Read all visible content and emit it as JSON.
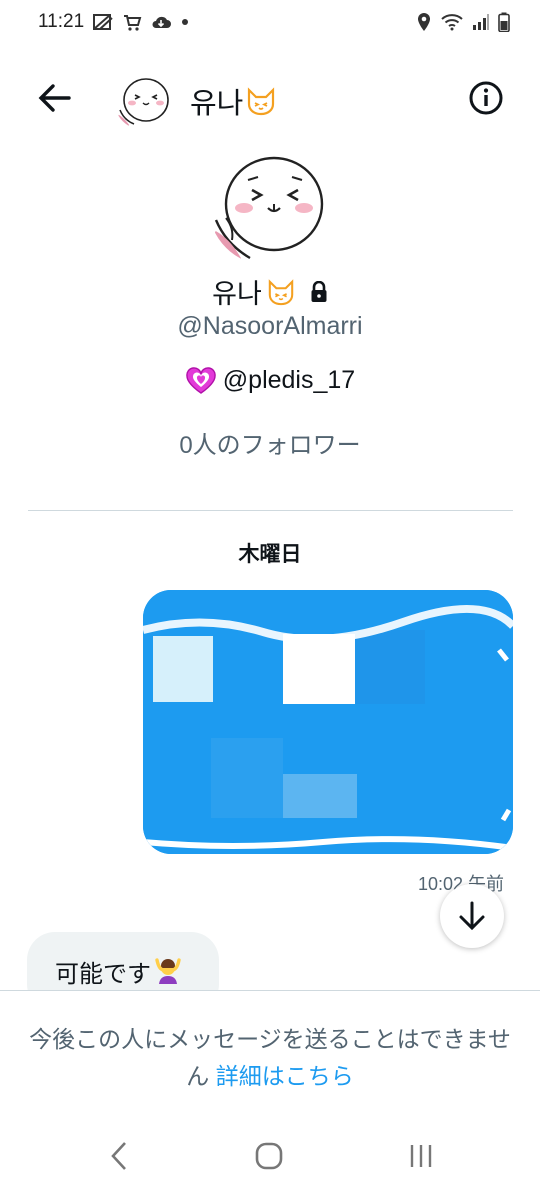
{
  "status_bar": {
    "time": "11:21",
    "left_icons": [
      "muted-cellular-icon",
      "shopping-cart-icon",
      "cloud-icon",
      "dot-icon"
    ],
    "right_icons": [
      "location-icon",
      "wifi-icon",
      "signal-icon",
      "battery-icon"
    ]
  },
  "header": {
    "name": "유나",
    "name_emoji": "🐱"
  },
  "profile": {
    "name": "유나",
    "name_emoji": "🐱",
    "handle": "@NasoorAlmarri",
    "bio_emoji": "💗",
    "bio_text": "@pledis_17",
    "followers": "0人のフォロワー"
  },
  "conversation": {
    "day_label": "木曜日",
    "sent_timestamp": "10:02 午前",
    "received_text": "可能です",
    "received_emoji": "🙆‍♀️"
  },
  "notice": {
    "text": "今後この人にメッセージを送ることはできません",
    "link": "詳細はこちら"
  },
  "colors": {
    "accent": "#1d9bf0",
    "secondary_text": "#536471",
    "bubble_received": "#eff3f4",
    "divider": "#cfd9de"
  }
}
